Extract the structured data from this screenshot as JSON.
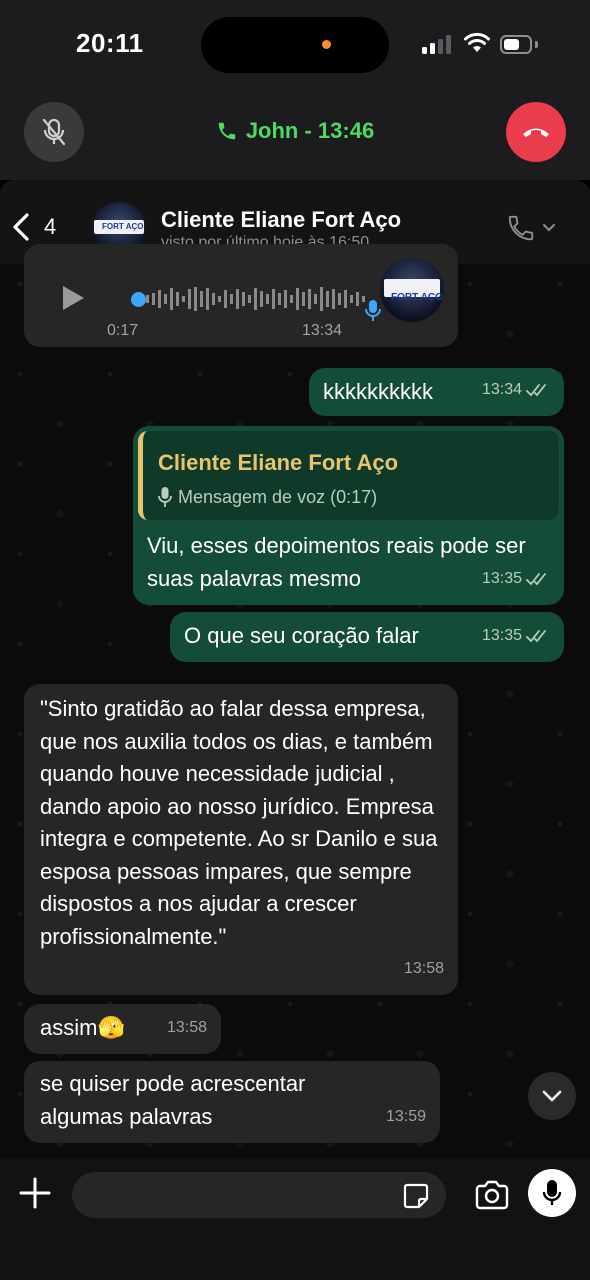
{
  "status_bar": {
    "time": "20:11"
  },
  "call_banner": {
    "title": "John - 13:46"
  },
  "chat_header": {
    "back_count": "4",
    "name": "Cliente Eliane Fort Aço",
    "status": "visto por último hoje às 16:50",
    "avatar_logo_text": "FORT AÇO"
  },
  "messages": {
    "voice": {
      "duration": "0:17",
      "time": "13:34"
    },
    "m1": {
      "text": "kkkkkkkkkk",
      "time": "13:34"
    },
    "m2": {
      "reply_name": "Cliente Eliane Fort Aço",
      "reply_sub": "Mensagem de voz (0:17)",
      "text": "Viu, esses depoimentos reais pode ser suas palavras mesmo",
      "time": "13:35"
    },
    "m3": {
      "text": "O que seu coração falar",
      "time": "13:35"
    },
    "m4": {
      "text": "\"Sinto gratidão ao falar dessa empresa, que nos auxilia todos os dias, e também quando houve necessidade judicial , dando apoio ao nosso jurídico. Empresa integra e competente. Ao sr Danilo e sua esposa pessoas impares, que sempre dispostos a nos ajudar a crescer profissionalmente.\"",
      "time": "13:58"
    },
    "m5": {
      "text": "assim",
      "emoji": "🫣",
      "time": "13:58"
    },
    "m6": {
      "text": "se quiser pode acrescentar algumas palavras",
      "time": "13:59"
    }
  },
  "input": {
    "value": "",
    "placeholder": ""
  },
  "colors": {
    "call_green": "#4cd964",
    "end_call_red": "#eb3c4b",
    "outgoing_bubble": "#144d37",
    "incoming_bubble": "#262626",
    "reply_accent": "#e8c56a",
    "voice_blue": "#3ba7ff"
  },
  "icons": [
    "mic-off-icon",
    "phone-icon",
    "end-call-icon",
    "chevron-left-icon",
    "phone-outline-icon",
    "chevron-down-icon",
    "play-icon",
    "mic-icon",
    "double-check-icon",
    "plus-icon",
    "sticker-icon",
    "camera-icon"
  ]
}
